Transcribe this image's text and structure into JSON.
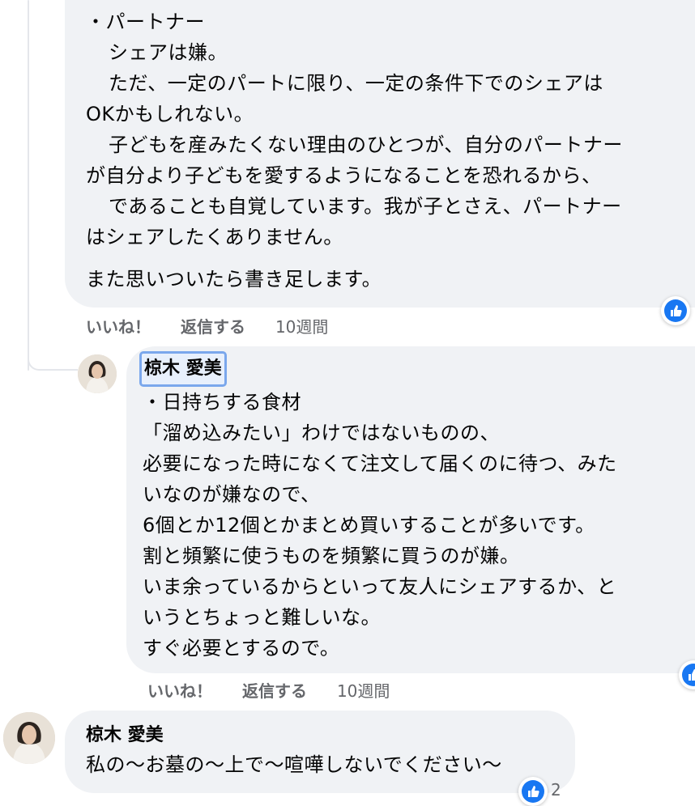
{
  "comment1": {
    "lines": [
      "・パートナー",
      "シェアは嫌。",
      "ただ、一定のパートに限り、一定の条件下でのシェアは",
      "OKかもしれない。",
      "子どもを産みたくない理由のひとつが、自分のパートナー",
      "が自分より子どもを愛するようになることを恐れるから、",
      "であることも自覚しています。我が子とさえ、パートナー",
      "はシェアしたくありません。",
      "また思いついたら書き足します。"
    ],
    "actions": {
      "like": "いいね！",
      "reply": "返信する",
      "time": "10週間"
    }
  },
  "comment2": {
    "author": "椋木 愛美",
    "lines": [
      "・日持ちする食材",
      "「溜め込みたい」わけではないものの、",
      "必要になった時になくて注文して届くのに待つ、みた",
      "いなのが嫌なので、",
      "6個とか12個とかまとめ買いすることが多いです。",
      "割と頻繁に使うものを頻繁に買うのが嫌。",
      "いま余っているからといって友人にシェアするか、と",
      "いうとちょっと難しいな。",
      "すぐ必要とするので。"
    ],
    "actions": {
      "like": "いいね！",
      "reply": "返信する",
      "time": "10週間"
    }
  },
  "comment3": {
    "author": "椋木 愛美",
    "text": "私の〜お墓の〜上で〜喧嘩しないでください〜",
    "reaction_count": "2"
  },
  "colors": {
    "like_blue": "#1877f2",
    "bubble": "#f0f2f5",
    "meta_gray": "#65676b"
  }
}
